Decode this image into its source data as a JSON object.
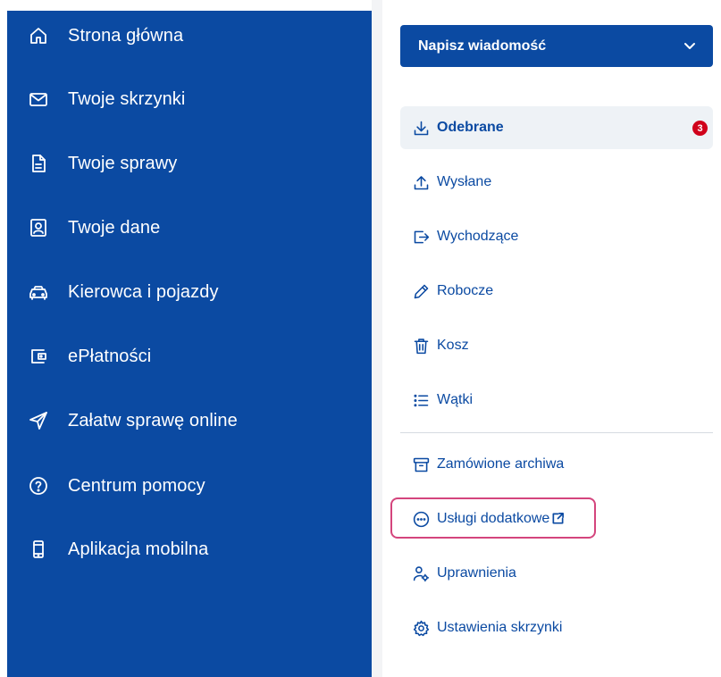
{
  "sidebar": {
    "items": [
      {
        "label": "Strona główna",
        "icon": "home-icon"
      },
      {
        "label": "Twoje skrzynki",
        "icon": "envelope-icon"
      },
      {
        "label": "Twoje sprawy",
        "icon": "document-icon"
      },
      {
        "label": "Twoje dane",
        "icon": "id-card-icon"
      },
      {
        "label": "Kierowca i pojazdy",
        "icon": "car-icon"
      },
      {
        "label": "ePłatności",
        "icon": "wallet-icon"
      },
      {
        "label": "Załatw sprawę online",
        "icon": "send-icon"
      },
      {
        "label": "Centrum pomocy",
        "icon": "help-icon"
      },
      {
        "label": "Aplikacja mobilna",
        "icon": "phone-icon"
      }
    ]
  },
  "compose": {
    "label": "Napisz wiadomość"
  },
  "mailbox": {
    "folders": [
      {
        "label": "Odebrane",
        "icon": "download-icon",
        "badge": "3",
        "active": true
      },
      {
        "label": "Wysłane",
        "icon": "upload-icon"
      },
      {
        "label": "Wychodzące",
        "icon": "outbox-icon"
      },
      {
        "label": "Robocze",
        "icon": "pencil-icon"
      },
      {
        "label": "Kosz",
        "icon": "trash-icon"
      },
      {
        "label": "Wątki",
        "icon": "list-icon"
      }
    ],
    "extras": [
      {
        "label": "Zamówione archiwa",
        "icon": "archive-icon"
      },
      {
        "label": "Usługi dodatkowe",
        "icon": "more-icon",
        "external": true
      },
      {
        "label": "Uprawnienia",
        "icon": "user-settings-icon"
      },
      {
        "label": "Ustawienia skrzynki",
        "icon": "gear-icon"
      }
    ]
  },
  "colors": {
    "brand": "#0b4aa2",
    "badge": "#d0021b",
    "highlight": "#d4457d",
    "active_bg": "#eef2f6"
  }
}
